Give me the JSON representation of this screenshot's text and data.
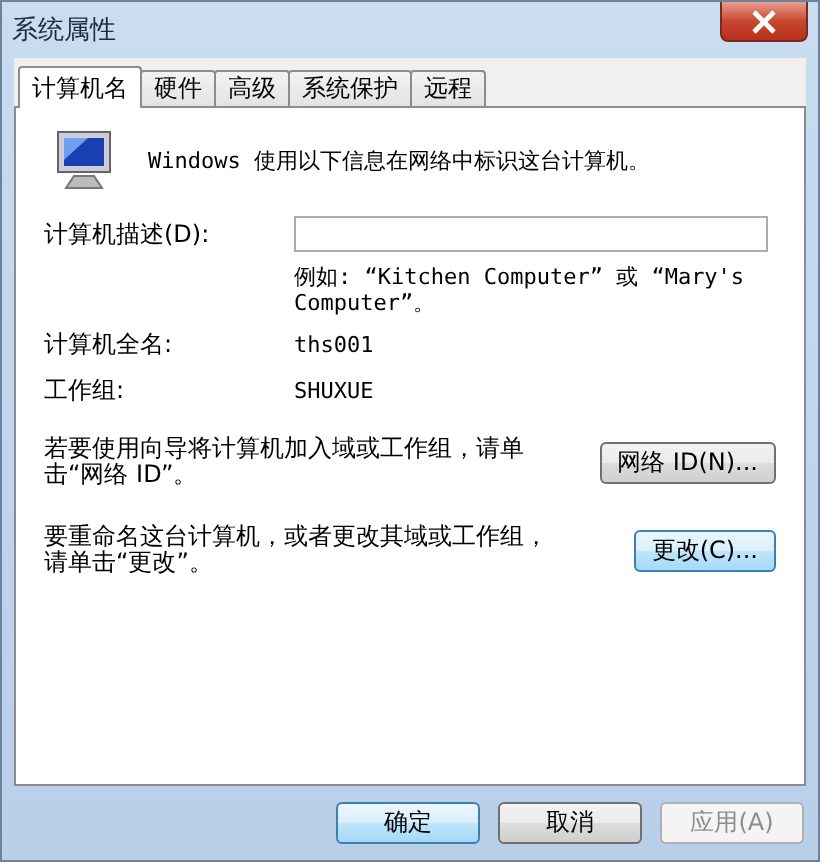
{
  "window": {
    "title": "系统属性"
  },
  "tabs": [
    {
      "label": "计算机名",
      "selected": true
    },
    {
      "label": "硬件",
      "selected": false
    },
    {
      "label": "高级",
      "selected": false
    },
    {
      "label": "系统保护",
      "selected": false
    },
    {
      "label": "远程",
      "selected": false
    }
  ],
  "intro": "Windows 使用以下信息在网络中标识这台计算机。",
  "description": {
    "label": "计算机描述(D):",
    "hint": "例如: “Kitchen Computer” 或 “Mary's Computer”。"
  },
  "info_rows": [
    {
      "label": "计算机全名:",
      "value": "ths001"
    },
    {
      "label": "工作组:",
      "value": "SHUXUE"
    }
  ],
  "actions": [
    {
      "text": "若要使用向导将计算机加入域或工作组，请单击“网络 ID”。",
      "button": "网络 ID(N)...",
      "focused": false
    },
    {
      "text": "要重命名这台计算机，或者更改其域或工作组，请单击“更改”。",
      "button": "更改(C)...",
      "focused": true
    }
  ],
  "footer_buttons": [
    {
      "label": "确定",
      "default": true,
      "disabled": false
    },
    {
      "label": "取消",
      "default": false,
      "disabled": false
    },
    {
      "label": "应用(A)",
      "default": false,
      "disabled": true
    }
  ]
}
